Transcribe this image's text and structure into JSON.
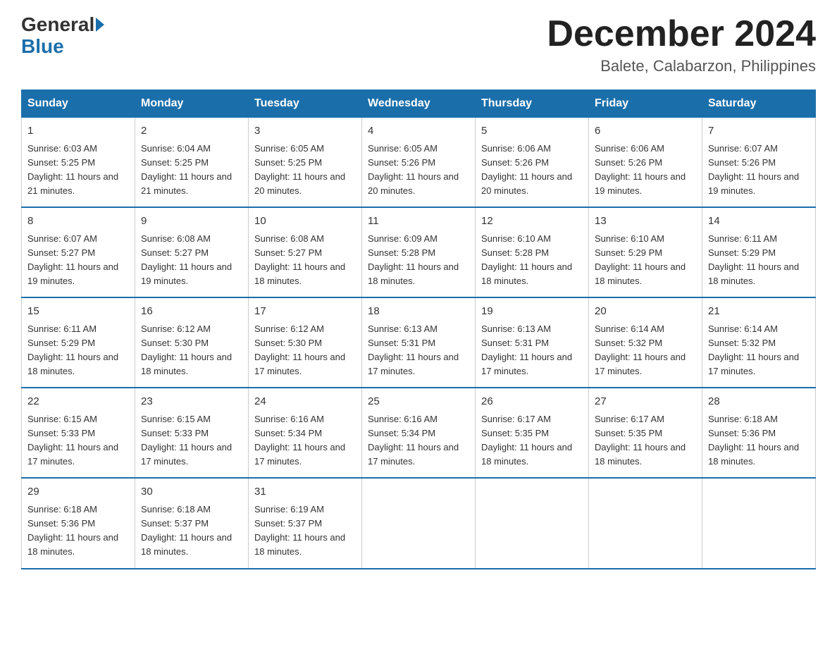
{
  "header": {
    "logo_general": "General",
    "logo_blue": "Blue",
    "title": "December 2024",
    "subtitle": "Balete, Calabarzon, Philippines"
  },
  "days_of_week": [
    "Sunday",
    "Monday",
    "Tuesday",
    "Wednesday",
    "Thursday",
    "Friday",
    "Saturday"
  ],
  "weeks": [
    [
      {
        "num": "1",
        "sunrise": "6:03 AM",
        "sunset": "5:25 PM",
        "daylight": "11 hours and 21 minutes."
      },
      {
        "num": "2",
        "sunrise": "6:04 AM",
        "sunset": "5:25 PM",
        "daylight": "11 hours and 21 minutes."
      },
      {
        "num": "3",
        "sunrise": "6:05 AM",
        "sunset": "5:25 PM",
        "daylight": "11 hours and 20 minutes."
      },
      {
        "num": "4",
        "sunrise": "6:05 AM",
        "sunset": "5:26 PM",
        "daylight": "11 hours and 20 minutes."
      },
      {
        "num": "5",
        "sunrise": "6:06 AM",
        "sunset": "5:26 PM",
        "daylight": "11 hours and 20 minutes."
      },
      {
        "num": "6",
        "sunrise": "6:06 AM",
        "sunset": "5:26 PM",
        "daylight": "11 hours and 19 minutes."
      },
      {
        "num": "7",
        "sunrise": "6:07 AM",
        "sunset": "5:26 PM",
        "daylight": "11 hours and 19 minutes."
      }
    ],
    [
      {
        "num": "8",
        "sunrise": "6:07 AM",
        "sunset": "5:27 PM",
        "daylight": "11 hours and 19 minutes."
      },
      {
        "num": "9",
        "sunrise": "6:08 AM",
        "sunset": "5:27 PM",
        "daylight": "11 hours and 19 minutes."
      },
      {
        "num": "10",
        "sunrise": "6:08 AM",
        "sunset": "5:27 PM",
        "daylight": "11 hours and 18 minutes."
      },
      {
        "num": "11",
        "sunrise": "6:09 AM",
        "sunset": "5:28 PM",
        "daylight": "11 hours and 18 minutes."
      },
      {
        "num": "12",
        "sunrise": "6:10 AM",
        "sunset": "5:28 PM",
        "daylight": "11 hours and 18 minutes."
      },
      {
        "num": "13",
        "sunrise": "6:10 AM",
        "sunset": "5:29 PM",
        "daylight": "11 hours and 18 minutes."
      },
      {
        "num": "14",
        "sunrise": "6:11 AM",
        "sunset": "5:29 PM",
        "daylight": "11 hours and 18 minutes."
      }
    ],
    [
      {
        "num": "15",
        "sunrise": "6:11 AM",
        "sunset": "5:29 PM",
        "daylight": "11 hours and 18 minutes."
      },
      {
        "num": "16",
        "sunrise": "6:12 AM",
        "sunset": "5:30 PM",
        "daylight": "11 hours and 18 minutes."
      },
      {
        "num": "17",
        "sunrise": "6:12 AM",
        "sunset": "5:30 PM",
        "daylight": "11 hours and 17 minutes."
      },
      {
        "num": "18",
        "sunrise": "6:13 AM",
        "sunset": "5:31 PM",
        "daylight": "11 hours and 17 minutes."
      },
      {
        "num": "19",
        "sunrise": "6:13 AM",
        "sunset": "5:31 PM",
        "daylight": "11 hours and 17 minutes."
      },
      {
        "num": "20",
        "sunrise": "6:14 AM",
        "sunset": "5:32 PM",
        "daylight": "11 hours and 17 minutes."
      },
      {
        "num": "21",
        "sunrise": "6:14 AM",
        "sunset": "5:32 PM",
        "daylight": "11 hours and 17 minutes."
      }
    ],
    [
      {
        "num": "22",
        "sunrise": "6:15 AM",
        "sunset": "5:33 PM",
        "daylight": "11 hours and 17 minutes."
      },
      {
        "num": "23",
        "sunrise": "6:15 AM",
        "sunset": "5:33 PM",
        "daylight": "11 hours and 17 minutes."
      },
      {
        "num": "24",
        "sunrise": "6:16 AM",
        "sunset": "5:34 PM",
        "daylight": "11 hours and 17 minutes."
      },
      {
        "num": "25",
        "sunrise": "6:16 AM",
        "sunset": "5:34 PM",
        "daylight": "11 hours and 17 minutes."
      },
      {
        "num": "26",
        "sunrise": "6:17 AM",
        "sunset": "5:35 PM",
        "daylight": "11 hours and 18 minutes."
      },
      {
        "num": "27",
        "sunrise": "6:17 AM",
        "sunset": "5:35 PM",
        "daylight": "11 hours and 18 minutes."
      },
      {
        "num": "28",
        "sunrise": "6:18 AM",
        "sunset": "5:36 PM",
        "daylight": "11 hours and 18 minutes."
      }
    ],
    [
      {
        "num": "29",
        "sunrise": "6:18 AM",
        "sunset": "5:36 PM",
        "daylight": "11 hours and 18 minutes."
      },
      {
        "num": "30",
        "sunrise": "6:18 AM",
        "sunset": "5:37 PM",
        "daylight": "11 hours and 18 minutes."
      },
      {
        "num": "31",
        "sunrise": "6:19 AM",
        "sunset": "5:37 PM",
        "daylight": "11 hours and 18 minutes."
      },
      null,
      null,
      null,
      null
    ]
  ]
}
